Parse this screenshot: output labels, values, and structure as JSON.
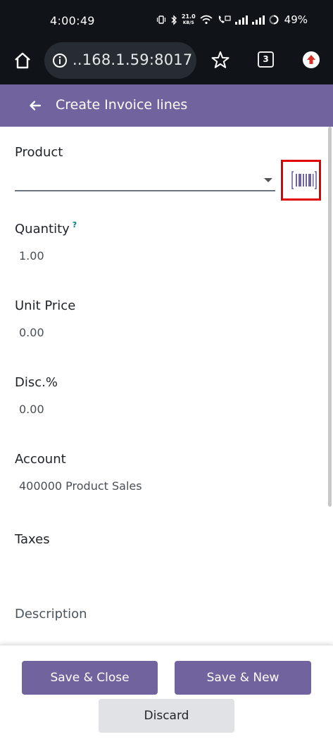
{
  "status_bar": {
    "time": "4:00:49",
    "net_speed_value": "21.0",
    "net_speed_unit": "KB/S",
    "battery": "49%"
  },
  "browser": {
    "url": "..168.1.59:8017",
    "tab_count": "3"
  },
  "header": {
    "title": "Create Invoice lines"
  },
  "form": {
    "product": {
      "label": "Product",
      "value": ""
    },
    "quantity": {
      "label": "Quantity",
      "help": "?",
      "value": "1.00"
    },
    "unit_price": {
      "label": "Unit Price",
      "value": "0.00"
    },
    "discount": {
      "label": "Disc.%",
      "value": "0.00"
    },
    "account": {
      "label": "Account",
      "value": "400000 Product Sales"
    },
    "taxes": {
      "label": "Taxes",
      "value": ""
    },
    "description": {
      "label": "Description"
    }
  },
  "footer": {
    "save_close_label": "Save & Close",
    "save_new_label": "Save & New",
    "discard_label": "Discard"
  },
  "colors": {
    "brand": "#71639e",
    "highlight": "#e00000"
  }
}
